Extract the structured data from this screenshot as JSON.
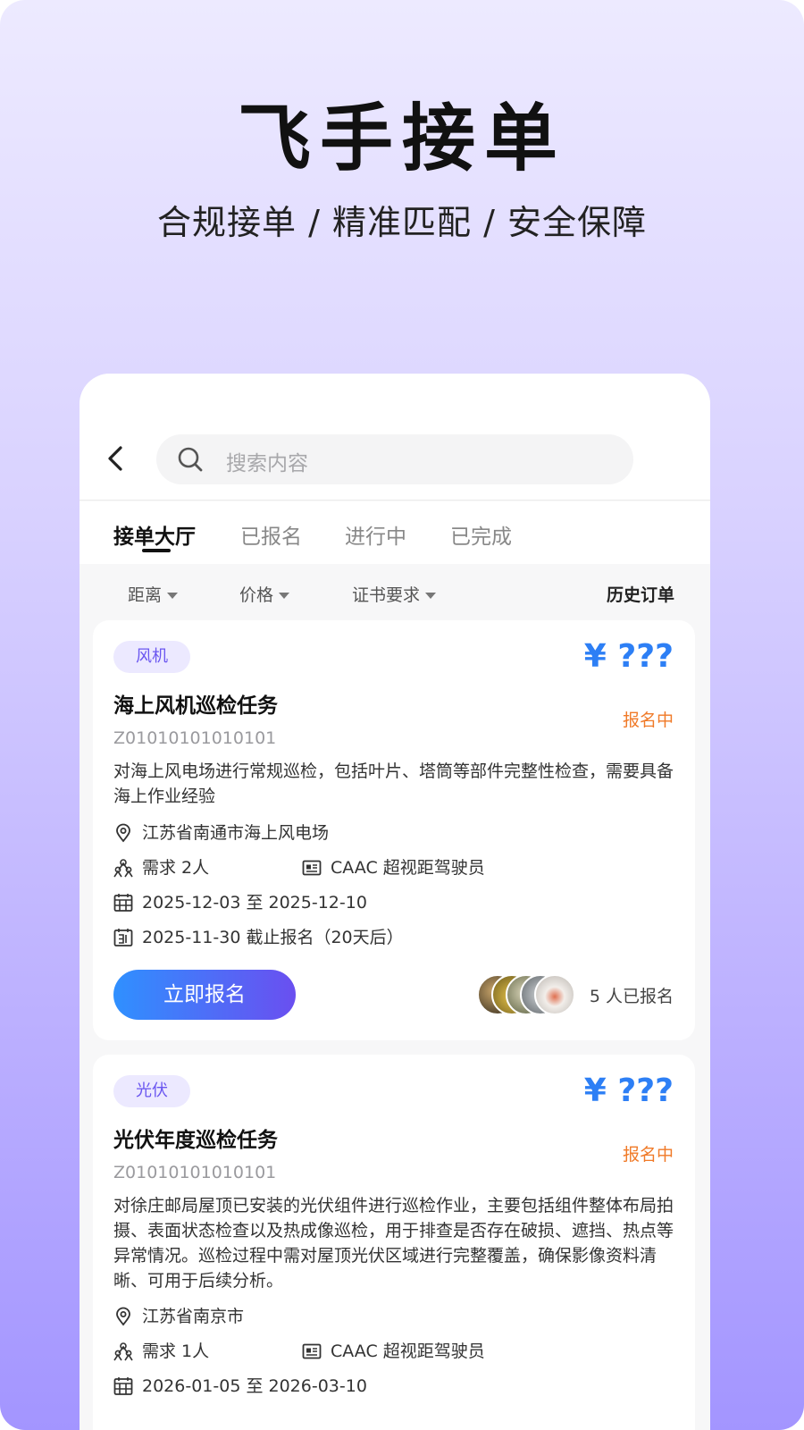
{
  "hero": {
    "title": "飞手接单",
    "subtitle": "合规接单 / 精准匹配 / 安全保障"
  },
  "search": {
    "placeholder": "搜索内容"
  },
  "tabs": [
    {
      "label": "接单大厅",
      "active": true
    },
    {
      "label": "已报名",
      "active": false
    },
    {
      "label": "进行中",
      "active": false
    },
    {
      "label": "已完成",
      "active": false
    }
  ],
  "filters": {
    "items": [
      "距离",
      "价格",
      "证书要求"
    ],
    "history": "历史订单"
  },
  "orders": [
    {
      "tag": "风机",
      "price": "¥ ???",
      "title": "海上风机巡检任务",
      "status": "报名中",
      "code": "Z01010101010101",
      "description": "对海上风电场进行常规巡检，包括叶片、塔筒等部件完整性检查，需要具备海上作业经验",
      "location": "江苏省南通市海上风电场",
      "people": "需求 2人",
      "license": "CAAC 超视距驾驶员",
      "period": "2025-12-03 至 2025-12-10",
      "deadline": "2025-11-30 截止报名（20天后）",
      "button": "立即报名",
      "signed": "5 人已报名"
    },
    {
      "tag": "光伏",
      "price": "¥ ???",
      "title": "光伏年度巡检任务",
      "status": "报名中",
      "code": "Z01010101010101",
      "description": "对徐庄邮局屋顶已安装的光伏组件进行巡检作业，主要包括组件整体布局拍摄、表面状态检查以及热成像巡检，用于排查是否存在破损、遮挡、热点等异常情况。巡检过程中需对屋顶光伏区域进行完整覆盖，确保影像资料清晰、可用于后续分析。",
      "location": "江苏省南京市",
      "people": "需求 1人",
      "license": "CAAC 超视距驾驶员",
      "period": "2026-01-05 至 2026-03-10"
    }
  ],
  "colors": {
    "accent": "#2d7ff5",
    "status": "#f07a28",
    "tag_bg": "#ece9ff",
    "tag_text": "#6a56f0"
  }
}
